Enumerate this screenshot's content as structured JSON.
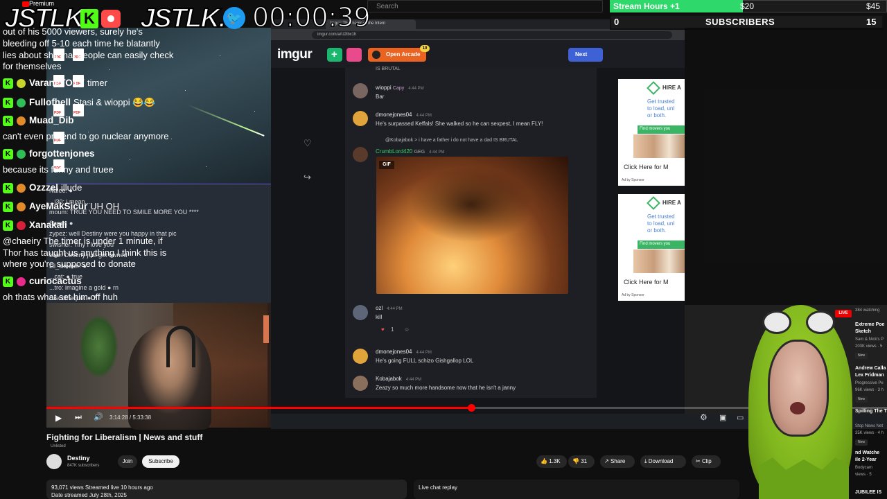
{
  "overlay": {
    "premium": "Premium",
    "brand_left": "JSTLK",
    "brand_k": "K",
    "brand_mid": "JSTLK.",
    "timer": "00:00:39",
    "goal_label": "Stream Hours +1",
    "goal_amount": "$20",
    "goal_amount2": "$45",
    "subs_left": "0",
    "subs_title": "SUBSCRIBERS",
    "subs_right": "15",
    "goal_progress": 0.48,
    "colors": {
      "kick_green": "#53fc18",
      "goal_green": "#2fd86a",
      "twitter_blue": "#1d9bf0"
    }
  },
  "youtube": {
    "search_placeholder": "Search",
    "video_title": "Fighting for Liberalism | News and stuff",
    "unlisted": "Unlisted",
    "channel_name": "Destiny",
    "channel_subs": "847K subscribers",
    "join": "Join",
    "subscribe": "Subscribe",
    "likes": "1.3K",
    "dislikes": "31",
    "share": "Share",
    "download": "Download",
    "clip": "Clip",
    "views": "93,071 views  Streamed live 10 hours ago",
    "date": "Date streamed July 28th, 2025",
    "live_chat_replay": "Live chat replay",
    "time": "3:14:28 / 5:33:38",
    "progress": 0.505,
    "accent": "#ff0000"
  },
  "stream_chat": [
    "Naiee: ●",
    "...i30: i mean...",
    "moum: TRUE YOU NEED TO SMILE MORE YOU ****",
    "Sarah: ●",
    "zypez: well Destiny were you happy in that pic",
    "swisher: Tiny I love you",
    "Lale: Destiny just got owned",
    "Lil_skeeter: ●",
    "...cat: ● true",
    "...tro: imagine a gold ● rn",
    "Discotheque: ● ?"
  ],
  "browser": {
    "tab": "Imgur: The magic of the Intern",
    "url": "imgur.com/a/U2lbx1h",
    "imgur_logo": "imgur",
    "open_arcade": "Open Arcade",
    "arcade_badge": "10",
    "next": "Next",
    "truncated_top": "IS BRUTAL",
    "comments": [
      {
        "user": "wioppi",
        "badge": "Capy",
        "time": "4:44 PM",
        "text": "Bar",
        "avatar_color": "#7a6660"
      },
      {
        "user": "dmonejones04",
        "badge": "",
        "time": "4:44 PM",
        "text": "He's surpassed Keffals! She walked so he can sexpest, I mean FLY!",
        "avatar_color": "#e1a43a"
      },
      {
        "user": "CrumbLord420",
        "badge": "GEG",
        "time": "4:44 PM",
        "reply": "@Kobajabok > i have a father i do not have a dad  IS BRUTAL",
        "text": "",
        "avatar_color": "#5a3a2a"
      },
      {
        "user": "ozl",
        "badge": "",
        "time": "4:44 PM",
        "text": "kill",
        "avatar_color": "#5d6678",
        "reaction_count": "1"
      },
      {
        "user": "dmonejones04",
        "badge": "",
        "time": "4:44 PM",
        "text": "He's going FULL schizo Gishgallop LOL",
        "avatar_color": "#e1a43a"
      },
      {
        "user": "Kobajabok",
        "badge": "",
        "time": "4:44 PM",
        "text": "Zeazy so much more handsome now that he isn't a janny",
        "avatar_color": "#8a6f5d"
      }
    ],
    "gif_label": "GIF",
    "ad": {
      "hire": "HIRE A",
      "body": "Get trusted\nto load, unl\nor both.",
      "find": "Find movers you",
      "click": "Click Here for M",
      "sponsor": "Ad by Sponsor"
    }
  },
  "chat": [
    {
      "name": "",
      "msg": "out of his 5000 viewers, surely he's",
      "dot": ""
    },
    {
      "name": "",
      "msg": "bleeding off 5-10 each time he blatantly",
      "dot": ""
    },
    {
      "name": "",
      "msg": "lies about shit that people can easily check",
      "dot": ""
    },
    {
      "name": "",
      "msg": "for themselves",
      "dot": ""
    },
    {
      "name": "VaraneTOTY",
      "msg": "timer",
      "dot": "#c8d62c"
    },
    {
      "name": "Fullofhell",
      "msg": "Stasi & wioppi 😂😂",
      "dot": "#2fbf56"
    },
    {
      "name": "Muad_Dib",
      "msg": "",
      "dot": "#e08a2a"
    },
    {
      "name": "",
      "msg": "can't even pretend to go nuclear anymore",
      "dot": ""
    },
    {
      "name": "forgottenjones",
      "msg": "",
      "dot": "#2fbf56"
    },
    {
      "name": "",
      "msg": "because its funny and truee",
      "dot": ""
    },
    {
      "name": "Ozzzel",
      "msg": "illude",
      "dot": "#e08a2a"
    },
    {
      "name": "AyeMakSicur",
      "msg": "UH OH",
      "dot": "#e08a2a"
    },
    {
      "name": "Xanakali",
      "msg": "",
      "dot": "#d6203a"
    },
    {
      "name": "",
      "msg": "@chaeiry The timer is under 1 minute, if",
      "dot": ""
    },
    {
      "name": "",
      "msg": "Thor has taught us anything I think this is",
      "dot": ""
    },
    {
      "name": "",
      "msg": "where you're supposed to donate",
      "dot": ""
    },
    {
      "name": "curiocactus",
      "msg": "",
      "dot": "#e82a8a"
    },
    {
      "name": "",
      "msg": "oh thats what set him off huh",
      "dot": ""
    }
  ],
  "recommended": {
    "live": "LIVE",
    "watching": "384 watching",
    "items": [
      {
        "title": "Extreme Poe",
        "line2": "Sketch",
        "line3": "Sam & Nick's P",
        "line4": "203K views · 5",
        "new": "New"
      },
      {
        "title": "Andrew Calla",
        "line2": "Lex Fridman",
        "line3": "Progressive Pe",
        "line4": "96K views · 3 h",
        "new": "New"
      },
      {
        "title": "Spilling The T",
        "line2": "",
        "line3": "Stop News Net",
        "line4": "35K views · 4 h",
        "new": "New"
      },
      {
        "title": "nd Watche",
        "line2": "ile 2-Year",
        "line3": "Bodycam",
        "line4": "views · 5",
        "new": ""
      },
      {
        "title": "JUBILEE IS",
        "line2": "",
        "line3": "",
        "line4": "",
        "new": ""
      }
    ]
  }
}
